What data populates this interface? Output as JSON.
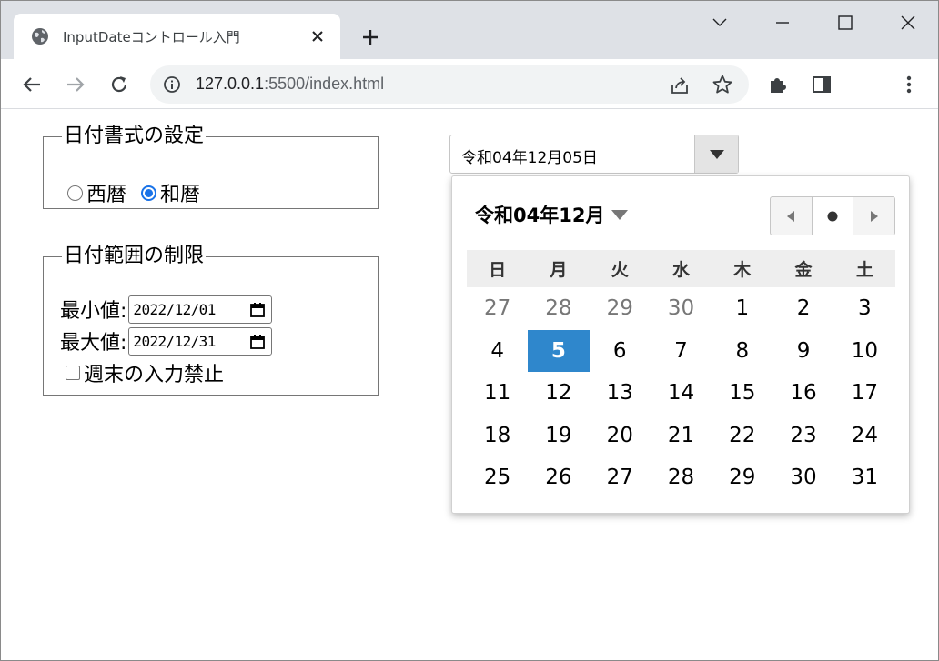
{
  "browser": {
    "tab_title": "InputDateコントロール入門",
    "url_host": "127.0.0.1",
    "url_rest": ":5500/index.html"
  },
  "format_group": {
    "legend": "日付書式の設定",
    "options": [
      {
        "label": "西暦",
        "checked": false
      },
      {
        "label": "和暦",
        "checked": true
      }
    ]
  },
  "range_group": {
    "legend": "日付範囲の制限",
    "min_label": "最小値:",
    "min_value": "2022/12/01",
    "max_label": "最大値:",
    "max_value": "2022/12/31",
    "weekend_label": "週末の入力禁止",
    "weekend_checked": false
  },
  "datepicker": {
    "value": "令和04年12月05日",
    "month_title": "令和04年12月",
    "weekdays": [
      "日",
      "月",
      "火",
      "水",
      "木",
      "金",
      "土"
    ],
    "weeks": [
      [
        {
          "d": "27",
          "o": true
        },
        {
          "d": "28",
          "o": true
        },
        {
          "d": "29",
          "o": true
        },
        {
          "d": "30",
          "o": true
        },
        {
          "d": "1"
        },
        {
          "d": "2"
        },
        {
          "d": "3"
        }
      ],
      [
        {
          "d": "4"
        },
        {
          "d": "5",
          "s": true
        },
        {
          "d": "6"
        },
        {
          "d": "7"
        },
        {
          "d": "8"
        },
        {
          "d": "9"
        },
        {
          "d": "10"
        }
      ],
      [
        {
          "d": "11"
        },
        {
          "d": "12"
        },
        {
          "d": "13"
        },
        {
          "d": "14"
        },
        {
          "d": "15"
        },
        {
          "d": "16"
        },
        {
          "d": "17"
        }
      ],
      [
        {
          "d": "18"
        },
        {
          "d": "19"
        },
        {
          "d": "20"
        },
        {
          "d": "21"
        },
        {
          "d": "22"
        },
        {
          "d": "23"
        },
        {
          "d": "24"
        }
      ],
      [
        {
          "d": "25"
        },
        {
          "d": "26"
        },
        {
          "d": "27"
        },
        {
          "d": "28"
        },
        {
          "d": "29"
        },
        {
          "d": "30"
        },
        {
          "d": "31"
        }
      ]
    ],
    "selected_color": "#2f87cc"
  },
  "icons": {
    "favicon": "globe-icon",
    "tab_close": "close-icon",
    "new_tab": "plus-icon",
    "back": "arrow-left-icon",
    "forward": "arrow-right-icon",
    "reload": "reload-icon",
    "site_info": "info-icon",
    "share": "share-icon",
    "bookmark": "star-icon",
    "extensions": "puzzle-icon",
    "side_panel": "side-panel-icon",
    "menu": "more-vertical-icon"
  }
}
